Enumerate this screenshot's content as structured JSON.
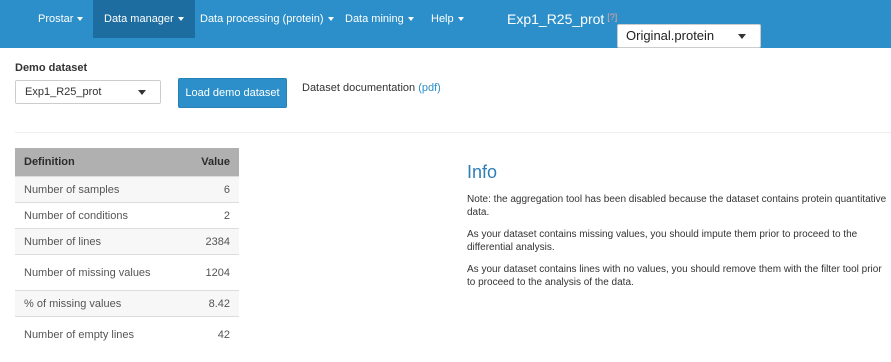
{
  "navbar": {
    "items": [
      {
        "label": "Prostar"
      },
      {
        "label": "Data manager"
      },
      {
        "label": "Data processing (protein)"
      },
      {
        "label": "Data mining"
      },
      {
        "label": "Help"
      }
    ],
    "dataset_name": "Exp1_R25_prot",
    "help_marker": "[?]",
    "version_select": "Original.protein"
  },
  "demo": {
    "label": "Demo dataset",
    "selected": "Exp1_R25_prot",
    "load_button": "Load demo dataset",
    "doc_text": "Dataset documentation",
    "doc_link": "(pdf)"
  },
  "stats_table": {
    "headers": [
      "Definition",
      "Value"
    ],
    "rows": [
      {
        "definition": "Number of samples",
        "value": "6"
      },
      {
        "definition": "Number of conditions",
        "value": "2"
      },
      {
        "definition": "Number of lines",
        "value": "2384"
      },
      {
        "definition": "Number of missing values",
        "value": "1204"
      },
      {
        "definition": "% of missing values",
        "value": "8.42"
      },
      {
        "definition": "Number of empty lines",
        "value": "42"
      }
    ]
  },
  "info": {
    "title": "Info",
    "paragraphs": [
      "Note: the aggregation tool has been disabled because the dataset contains protein quantitative data.",
      "As your dataset contains missing values, you should impute them prior to proceed to the differential analysis.",
      "As your dataset contains lines with no values, you should remove them with the filter tool prior to proceed to the analysis of the data."
    ]
  },
  "colors": {
    "navbar": "#2c8fc9",
    "navbar_active": "#1d6da0",
    "table_header": "#b0b0b0",
    "info_title": "#2c7fb8"
  }
}
